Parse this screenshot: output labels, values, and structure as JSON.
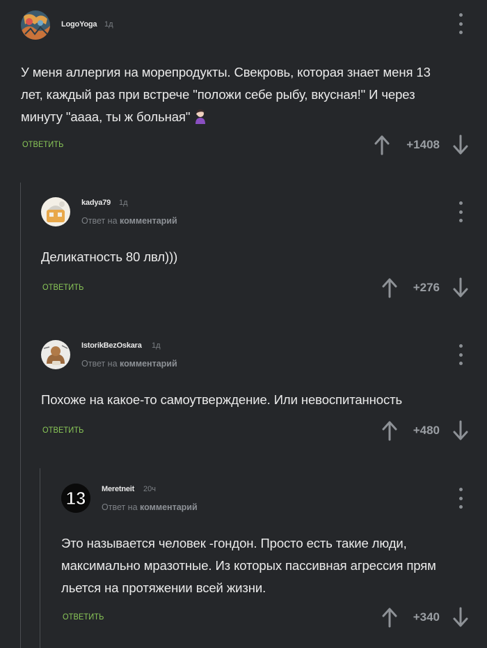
{
  "comments": [
    {
      "username": "LogoYoga",
      "time": "1д",
      "text_lines": [
        "У меня аллергия на морепродукты. Свекровь, которая знает меня 13",
        "лет, каждый раз при встрече \"положи себе рыбу, вкусная!\" И через",
        "минуту \"аааа, ты ж больная\""
      ],
      "reply_label": "ОТВЕТИТЬ",
      "rating": "+1408",
      "emoji": "woman-facepalming-icon"
    },
    {
      "username": "kadya79",
      "time": "1д",
      "reply_prefix": "Ответ на",
      "reply_target": "комментарий",
      "text_lines": [
        "Деликатность 80 лвл)))"
      ],
      "reply_label": "ОТВЕТИТЬ",
      "rating": "+276"
    },
    {
      "username": "IstorikBezOskara",
      "time": "1д",
      "reply_prefix": "Ответ на",
      "reply_target": "комментарий",
      "text_lines": [
        "Похоже на какое-то самоутверждение. Или невоспитанность"
      ],
      "reply_label": "ОТВЕТИТЬ",
      "rating": "+480"
    },
    {
      "username": "Meretneit",
      "time": "20ч",
      "avatar_text": "13",
      "reply_prefix": "Ответ на",
      "reply_target": "комментарий",
      "text_lines": [
        "Это называется человек -гондон. Просто есть такие люди,",
        "максимально мразотные. Из которых пассивная агрессия прям",
        "льется на протяжении всей жизни."
      ],
      "reply_label": "ОТВЕТИТЬ",
      "rating": "+340"
    }
  ],
  "colors": {
    "background": "#25272a",
    "reply_button": "#8ac858",
    "thread_line": "#4a4d51",
    "muted_text": "#7d8186"
  }
}
